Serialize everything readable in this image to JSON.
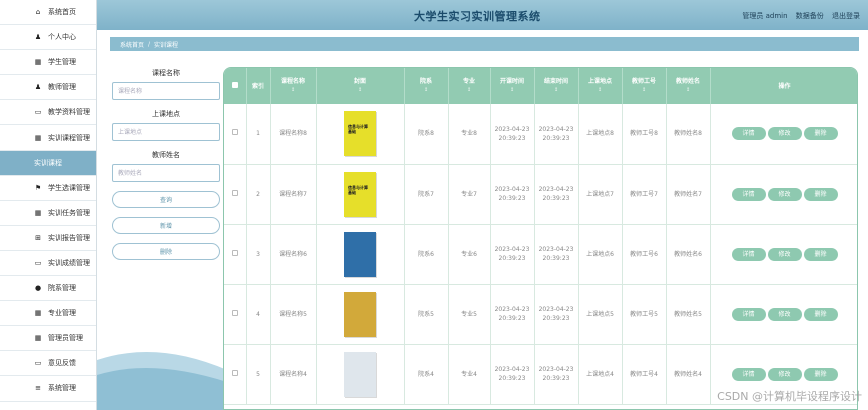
{
  "sidebar": {
    "items": [
      {
        "icon": "home-icon",
        "glyph": "⌂",
        "label": "系统首页"
      },
      {
        "icon": "person-icon",
        "glyph": "♟",
        "label": "个人中心"
      },
      {
        "icon": "grid-icon",
        "glyph": "▦",
        "label": "学生管理"
      },
      {
        "icon": "person-icon",
        "glyph": "♟",
        "label": "教师管理"
      },
      {
        "icon": "monitor-icon",
        "glyph": "▭",
        "label": "教学资料管理"
      },
      {
        "icon": "grid-icon",
        "glyph": "▦",
        "label": "实训课程管理"
      },
      {
        "icon": "none",
        "glyph": "",
        "label": "实训课程",
        "active": true
      },
      {
        "icon": "flag-icon",
        "glyph": "⚑",
        "label": "学生选课管理"
      },
      {
        "icon": "grid-icon",
        "glyph": "▦",
        "label": "实训任务管理"
      },
      {
        "icon": "table-icon",
        "glyph": "⊞",
        "label": "实训报告管理"
      },
      {
        "icon": "monitor-icon",
        "glyph": "▭",
        "label": "实训成绩管理"
      },
      {
        "icon": "location-icon",
        "glyph": "●",
        "label": "院系管理"
      },
      {
        "icon": "grid-icon",
        "glyph": "▦",
        "label": "专业管理"
      },
      {
        "icon": "grid-icon",
        "glyph": "▦",
        "label": "管理员管理"
      },
      {
        "icon": "monitor-icon",
        "glyph": "▭",
        "label": "意见反馈"
      },
      {
        "icon": "list-icon",
        "glyph": "≡",
        "label": "系统管理"
      }
    ]
  },
  "header": {
    "title": "大学生实习实训管理系统",
    "role": "管理员 admin",
    "backup": "数据备份",
    "logout": "退出登录"
  },
  "breadcrumb": {
    "home": "系统首页",
    "separator": "/",
    "current": "实训课程"
  },
  "search": {
    "course_label": "课程名称",
    "course_placeholder": "课程名称",
    "location_label": "上课地点",
    "location_placeholder": "上课地点",
    "teacher_label": "教师姓名",
    "teacher_placeholder": "教师姓名",
    "query_button": "查询",
    "add_button": "新增",
    "delete_button": "删除"
  },
  "table": {
    "headers": [
      "索引",
      "课程名称",
      "封面",
      "院系",
      "专业",
      "开课时间",
      "结束时间",
      "上课地点",
      "教师工号",
      "教师姓名",
      "操作"
    ],
    "sort_mark": "↕",
    "action_labels": {
      "detail": "详情",
      "edit": "修改",
      "delete": "删除"
    },
    "rows": [
      {
        "index": "1",
        "course": "课程名称8",
        "cover_title": "信息与计算\n基础",
        "cover_color": "#e6df2a",
        "dept": "院系8",
        "major": "专业8",
        "start": "2023-04-23 20:39:23",
        "end": "2023-04-23 20:39:23",
        "location": "上课地点8",
        "teacher_id": "教师工号8",
        "teacher_name": "教师姓名8"
      },
      {
        "index": "2",
        "course": "课程名称7",
        "cover_title": "信息与计算\n基础",
        "cover_color": "#e6df2a",
        "dept": "院系7",
        "major": "专业7",
        "start": "2023-04-23 20:39:23",
        "end": "2023-04-23 20:39:23",
        "location": "上课地点7",
        "teacher_id": "教师工号7",
        "teacher_name": "教师姓名7"
      },
      {
        "index": "3",
        "course": "课程名称6",
        "cover_title": "",
        "cover_color": "#2f6fa8",
        "dept": "院系6",
        "major": "专业6",
        "start": "2023-04-23 20:39:23",
        "end": "2023-04-23 20:39:23",
        "location": "上课地点6",
        "teacher_id": "教师工号6",
        "teacher_name": "教师姓名6"
      },
      {
        "index": "4",
        "course": "课程名称5",
        "cover_title": "",
        "cover_color": "#d2a93a",
        "dept": "院系5",
        "major": "专业5",
        "start": "2023-04-23 20:39:23",
        "end": "2023-04-23 20:39:23",
        "location": "上课地点5",
        "teacher_id": "教师工号5",
        "teacher_name": "教师姓名5"
      },
      {
        "index": "5",
        "course": "课程名称4",
        "cover_title": "",
        "cover_color": "#dfe6ec",
        "dept": "院系4",
        "major": "专业4",
        "start": "2023-04-23 20:39:23",
        "end": "2023-04-23 20:39:23",
        "location": "上课地点4",
        "teacher_id": "教师工号4",
        "teacher_name": "教师姓名4"
      }
    ]
  },
  "watermark": "CSDN @计算机毕设程序设计",
  "colors": {
    "accent": "#8ec9b0",
    "header": "#8bbccf",
    "sidebar_active": "#7fb0c7"
  }
}
